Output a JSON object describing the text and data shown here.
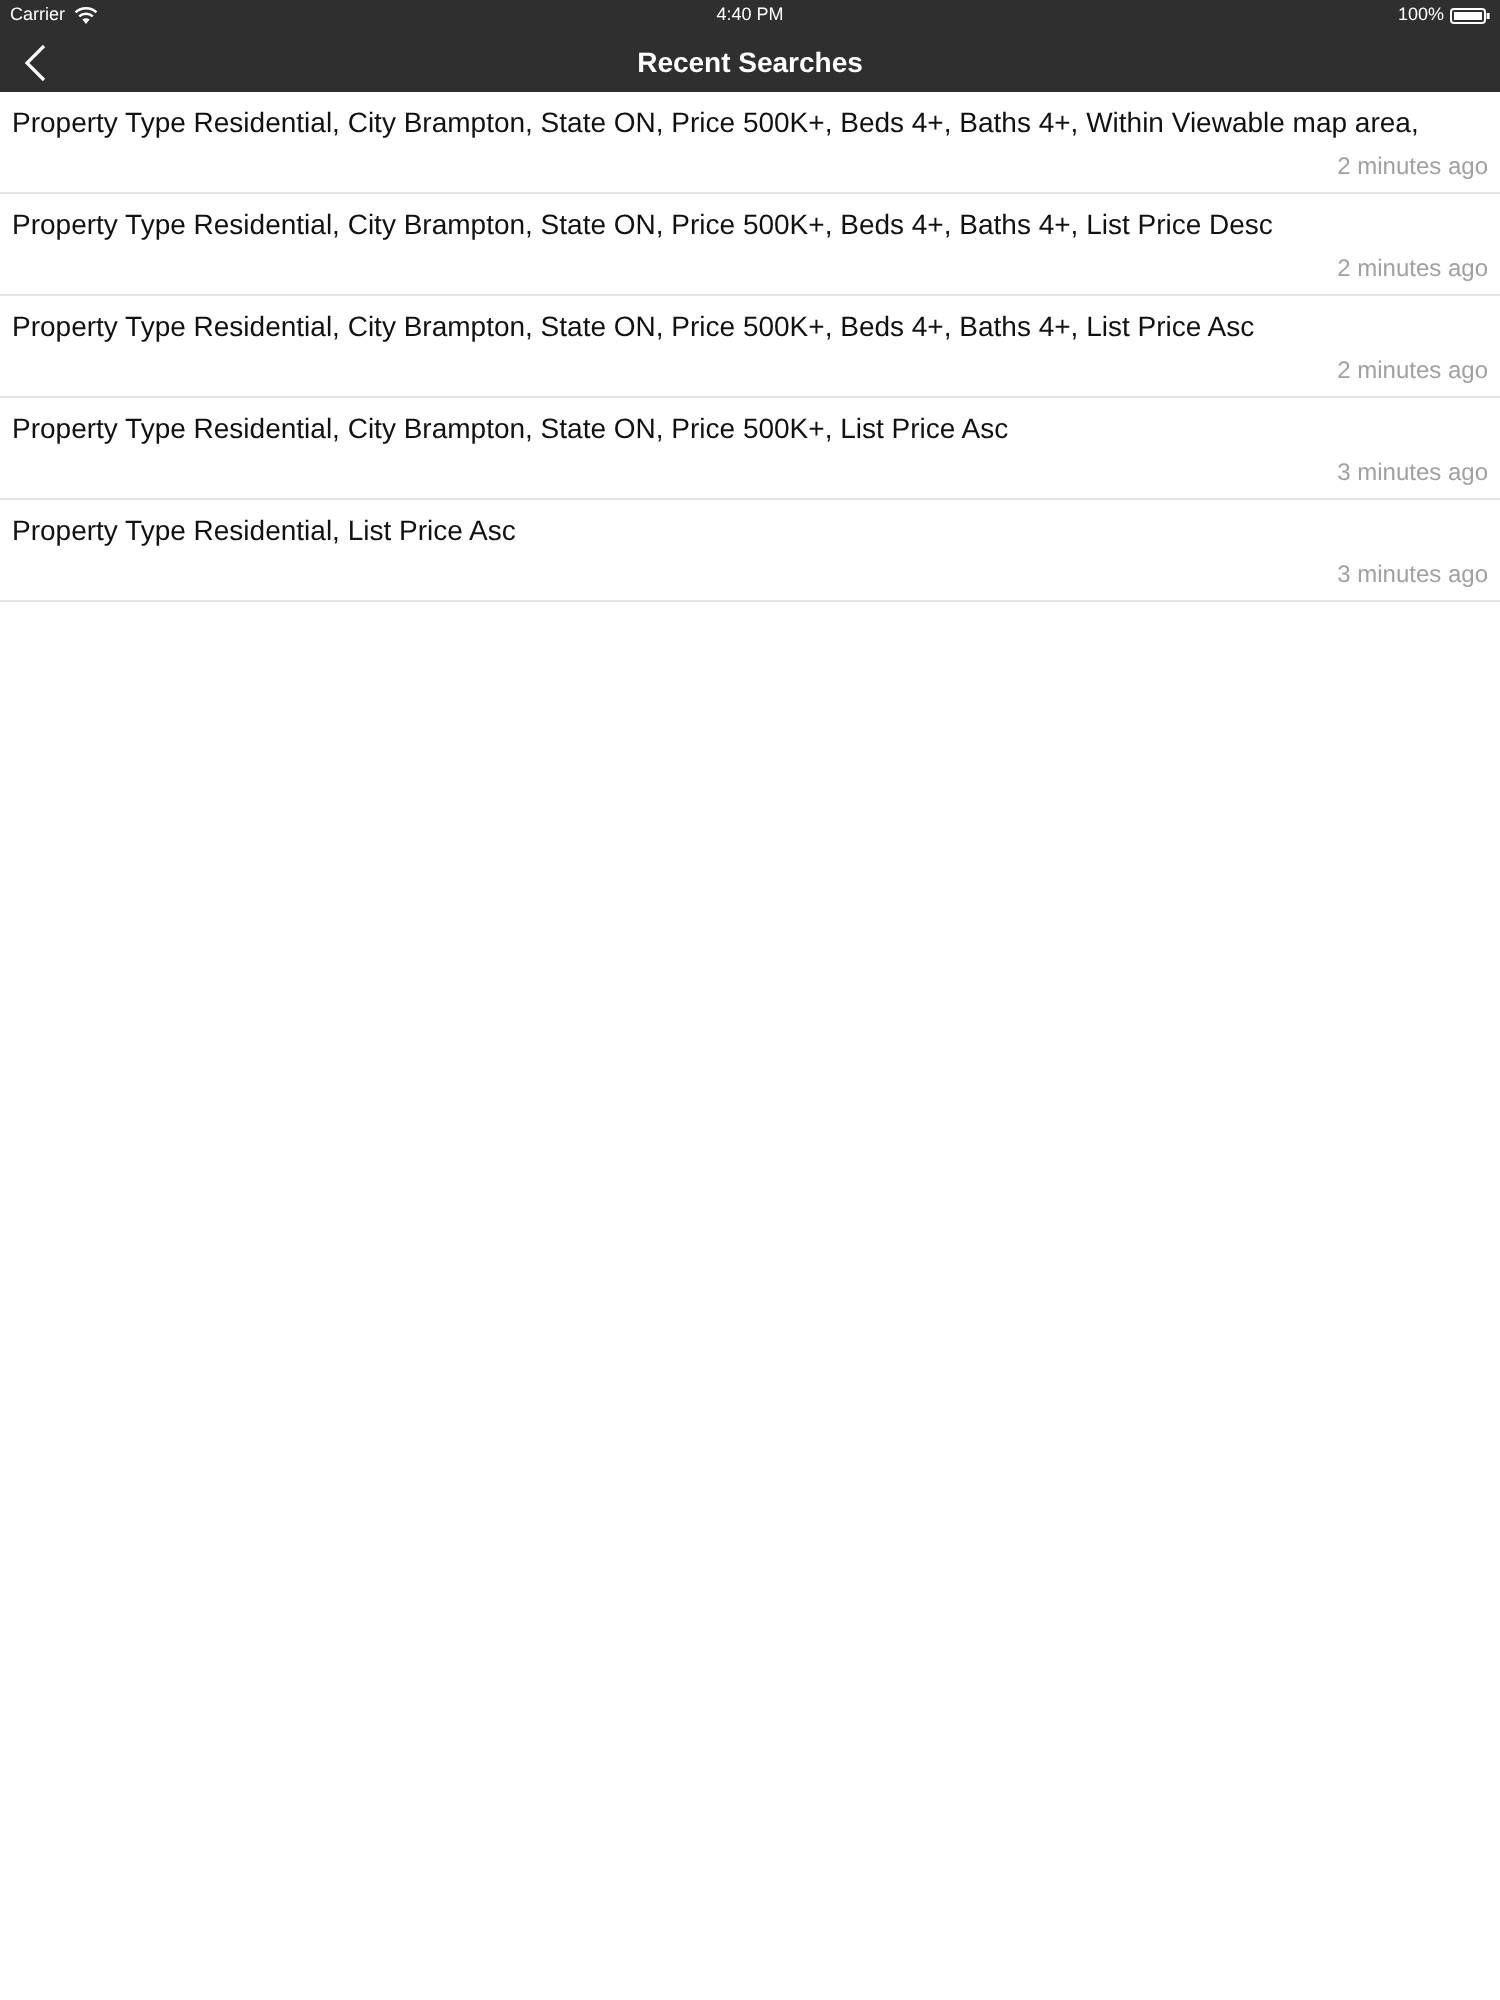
{
  "status_bar": {
    "carrier": "Carrier",
    "time": "4:40 PM",
    "battery": "100%"
  },
  "nav_bar": {
    "title": "Recent Searches"
  },
  "searches": [
    {
      "query": "Property Type Residential, City Brampton, State ON, Price 500K+, Beds 4+, Baths 4+, Within Viewable map area,",
      "time": "2 minutes ago"
    },
    {
      "query": "Property Type Residential, City Brampton, State ON, Price 500K+, Beds 4+, Baths 4+, List Price Desc",
      "time": "2 minutes ago"
    },
    {
      "query": "Property Type Residential, City Brampton, State ON, Price 500K+, Beds 4+, Baths 4+, List Price Asc",
      "time": "2 minutes ago"
    },
    {
      "query": "Property Type Residential, City Brampton, State ON, Price 500K+, List Price Asc",
      "time": "3 minutes ago"
    },
    {
      "query": "Property Type Residential, List Price Asc",
      "time": "3 minutes ago"
    }
  ]
}
